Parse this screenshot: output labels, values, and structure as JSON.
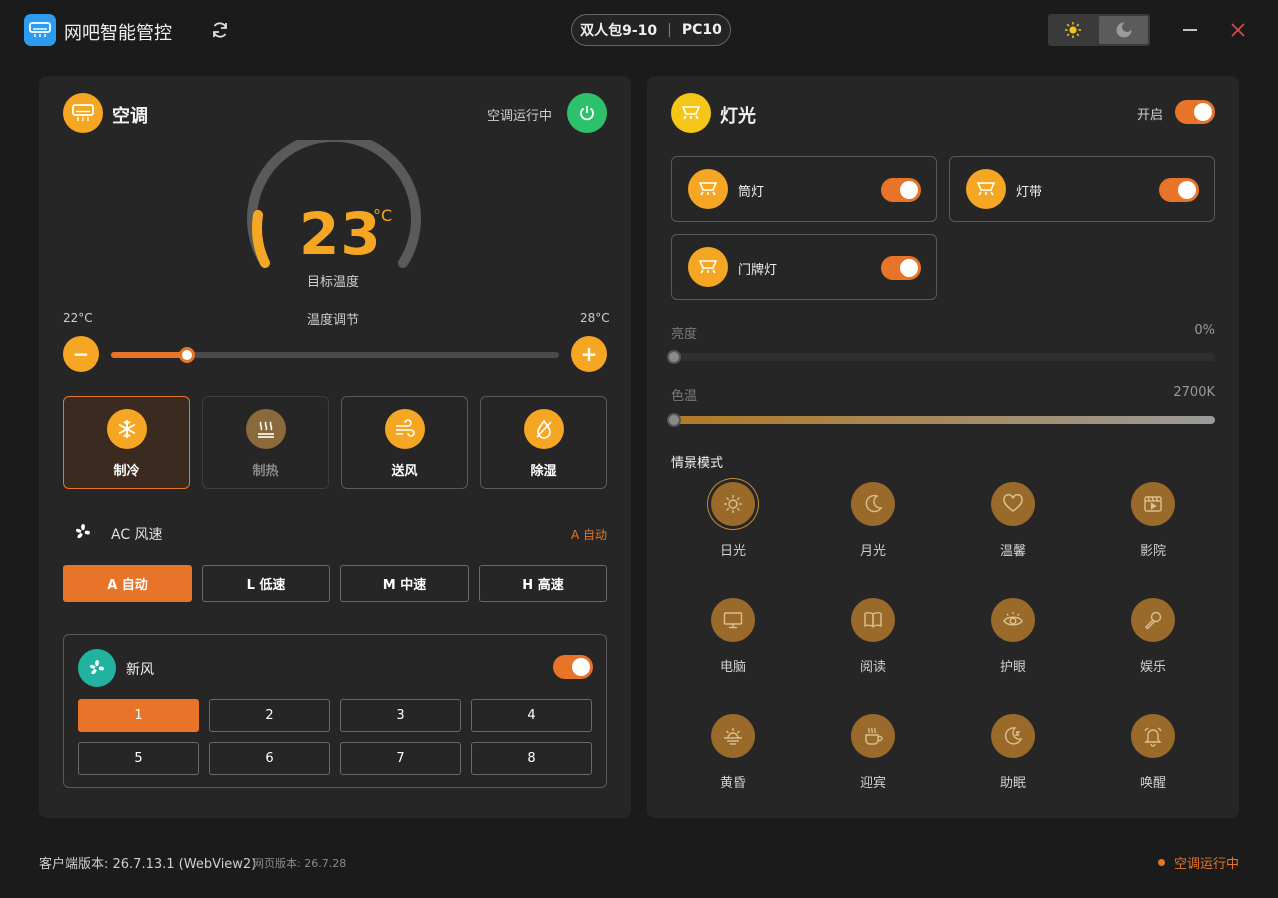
{
  "app": {
    "title": "网吧智能管控"
  },
  "device": {
    "room": "双人包9-10",
    "pc": "PC10"
  },
  "theme": {
    "current": "dark"
  },
  "ac": {
    "title": "空调",
    "status": "空调运行中",
    "temperature": "23",
    "unit": "°C",
    "target_label": "目标温度",
    "min_label": "22°C",
    "max_label": "28°C",
    "adjust_label": "温度调节",
    "minus_label": "−",
    "plus_label": "+",
    "slider_fraction": 0.17,
    "modes": [
      {
        "label": "制冷",
        "icon": "snowflake-icon",
        "state": "active"
      },
      {
        "label": "制热",
        "icon": "heat-icon",
        "state": "disabled"
      },
      {
        "label": "送风",
        "icon": "wind-icon",
        "state": "normal"
      },
      {
        "label": "除湿",
        "icon": "dehumidify-icon",
        "state": "normal"
      }
    ],
    "fan": {
      "title": "AC 风速",
      "current": "A 自动",
      "speeds": [
        {
          "label": "A 自动",
          "active": true
        },
        {
          "label": "L 低速",
          "active": false
        },
        {
          "label": "M 中速",
          "active": false
        },
        {
          "label": "H 高速",
          "active": false
        }
      ]
    }
  },
  "fresh_air": {
    "title": "新风",
    "enabled": true,
    "levels": [
      "1",
      "2",
      "3",
      "4",
      "5",
      "6",
      "7",
      "8"
    ],
    "active_level": "1"
  },
  "lights": {
    "title": "灯光",
    "status": "开启",
    "devices": [
      {
        "label": "筒灯",
        "on": true
      },
      {
        "label": "灯带",
        "on": true
      },
      {
        "label": "门牌灯",
        "on": true
      }
    ],
    "brightness": {
      "label": "亮度",
      "value": "0%"
    },
    "color_temp": {
      "label": "色温",
      "value": "2700K"
    },
    "scene_title": "情景模式",
    "scenes": [
      {
        "label": "日光",
        "icon": "sun-icon",
        "active": true
      },
      {
        "label": "月光",
        "icon": "moon-icon",
        "active": false
      },
      {
        "label": "温馨",
        "icon": "heart-icon",
        "active": false
      },
      {
        "label": "影院",
        "icon": "film-icon",
        "active": false
      },
      {
        "label": "电脑",
        "icon": "monitor-icon",
        "active": false
      },
      {
        "label": "阅读",
        "icon": "book-icon",
        "active": false
      },
      {
        "label": "护眼",
        "icon": "eye-icon",
        "active": false
      },
      {
        "label": "娱乐",
        "icon": "microphone-icon",
        "active": false
      },
      {
        "label": "黄昏",
        "icon": "sunset-icon",
        "active": false
      },
      {
        "label": "迎宾",
        "icon": "coffee-icon",
        "active": false
      },
      {
        "label": "助眠",
        "icon": "sleep-moon-icon",
        "active": false
      },
      {
        "label": "唤醒",
        "icon": "bell-icon",
        "active": false
      }
    ]
  },
  "footer": {
    "client_version": "客户端版本: 26.7.13.1 (WebView2)",
    "web_version": "网页版本: 26.7.28",
    "status": "空调运行中"
  },
  "colors": {
    "accent": "#e8742a",
    "icon": "#f5a623",
    "power": "#2cc16b",
    "fresh": "#22b3a0"
  }
}
